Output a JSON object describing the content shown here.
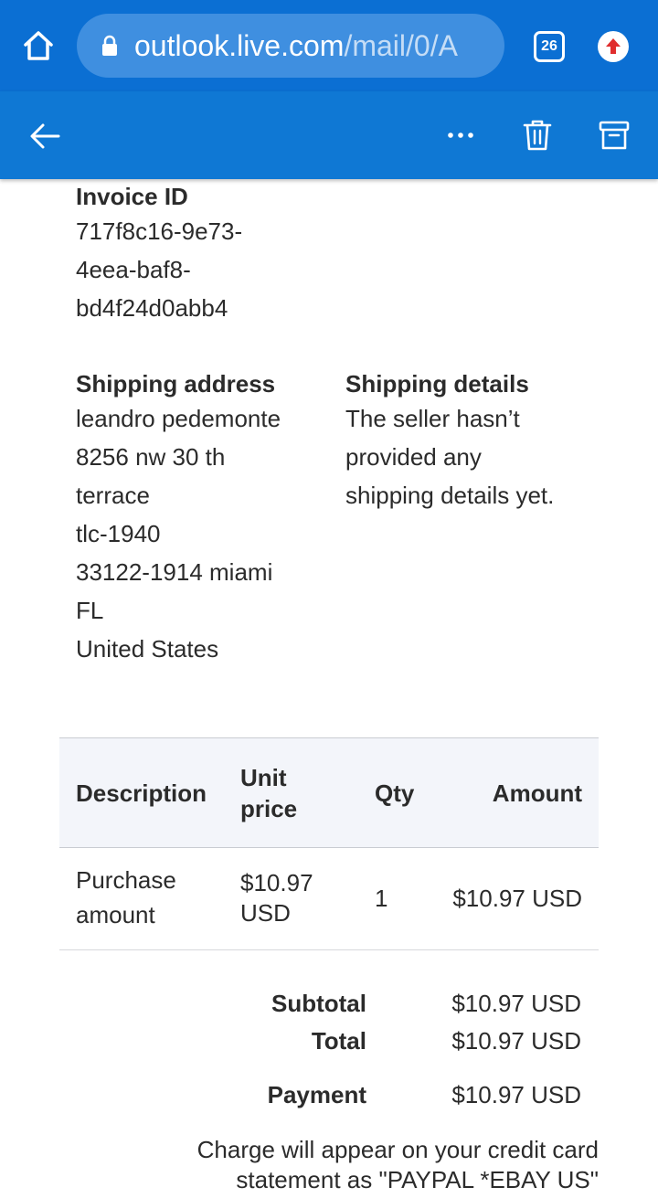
{
  "browser": {
    "url_main": "outlook.live.com",
    "url_rest": "/mail/0/A",
    "tab_count": "26"
  },
  "invoice": {
    "id_label": "Invoice ID",
    "id_lines": [
      "717f8c16-9e73-",
      "4eea-baf8-",
      "bd4f24d0abb4"
    ]
  },
  "shipping_address": {
    "label": "Shipping address",
    "lines": [
      "leandro pedemonte",
      "8256 nw 30 th",
      "terrace",
      "tlc-1940",
      "33122-1914 miami",
      "FL",
      "United States"
    ]
  },
  "shipping_details": {
    "label": "Shipping details",
    "lines": [
      "The seller hasn’t",
      "provided any",
      "shipping details yet."
    ]
  },
  "table": {
    "headers": {
      "description": "Description",
      "unit_price_1": "Unit",
      "unit_price_2": "price",
      "qty": "Qty",
      "amount": "Amount"
    },
    "rows": [
      {
        "description_1": "Purchase",
        "description_2": "amount",
        "unit_price_1": "$10.97",
        "unit_price_2": "USD",
        "qty": "1",
        "amount": "$10.97 USD"
      }
    ]
  },
  "totals": {
    "subtotal_label": "Subtotal",
    "subtotal_value": "$10.97 USD",
    "total_label": "Total",
    "total_value": "$10.97 USD",
    "payment_label": "Payment",
    "payment_value": "$10.97 USD"
  },
  "charge_note": {
    "line1": "Charge will appear on your credit card",
    "line2": "statement as \"PAYPAL *EBAY US\""
  }
}
